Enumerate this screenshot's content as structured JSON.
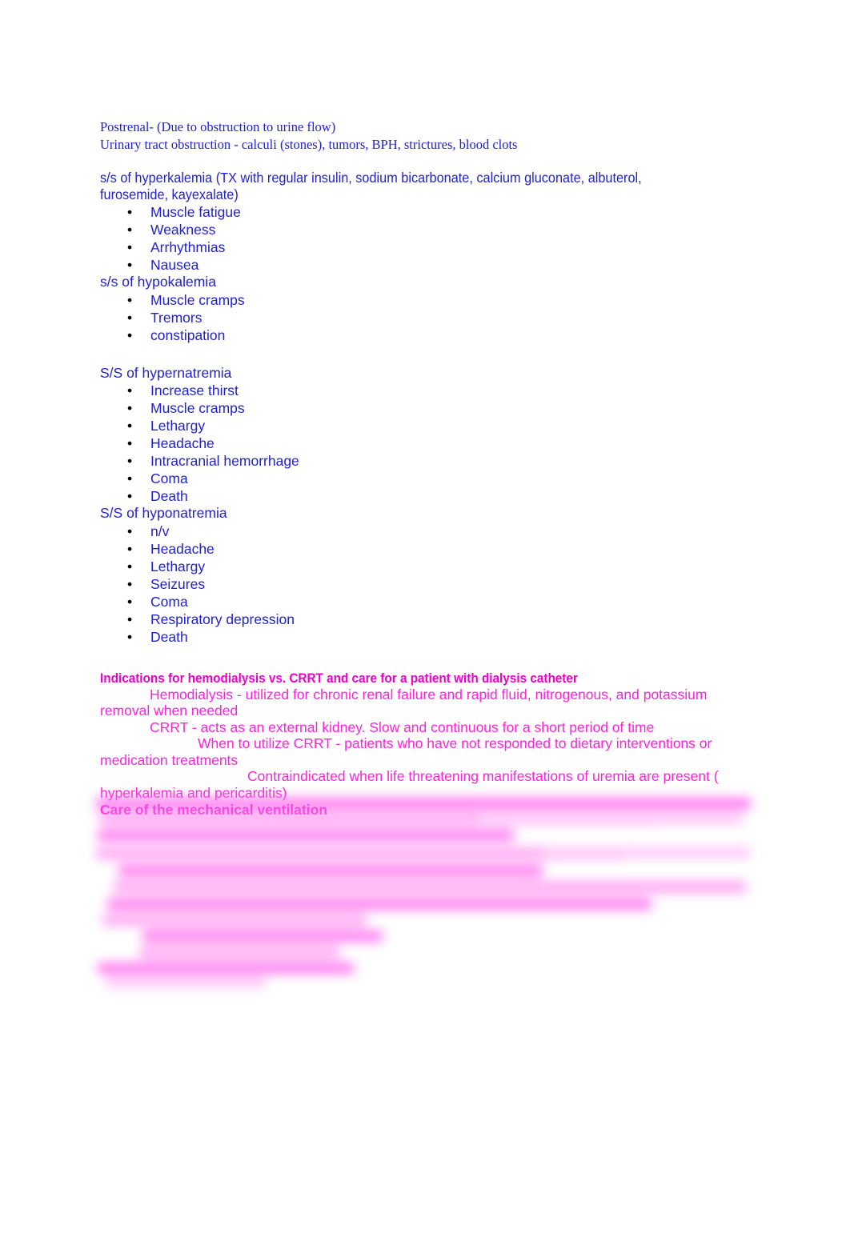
{
  "document": {
    "title": "Nursing Study Notes - Renal and Dialysis",
    "colors": {
      "blue_text": "#2222cc",
      "magenta_text": "#ff22dd",
      "magenta_heading": "#ee00cc",
      "bullet": "#000000",
      "page_background": "#ffffff"
    }
  },
  "section_postrenal": {
    "line1": "Postrenal- (Due to obstruction to urine flow)",
    "line2": "Urinary tract obstruction - calculi (stones), tumors, BPH, strictures, blood clots"
  },
  "section_hyperkalemia": {
    "heading": "s/s of hyperkalemia (TX with regular insulin, sodium bicarbonate, calcium gluconate, albuterol, furosemide, kayexalate)",
    "bullets": [
      "Muscle fatigue",
      "Weakness",
      "Arrhythmias",
      "Nausea"
    ]
  },
  "section_hypokalemia": {
    "heading": "s/s of hypokalemia",
    "bullets": [
      "Muscle cramps",
      "Tremors",
      "constipation"
    ]
  },
  "section_hypernatremia": {
    "heading": "S/S of hypernatremia",
    "bullets": [
      "Increase thirst",
      "Muscle cramps",
      "Lethargy",
      "Headache",
      "Intracranial hemorrhage",
      "Coma",
      "Death"
    ]
  },
  "section_hyponatremia": {
    "heading": "S/S of hyponatremia",
    "bullets": [
      "n/v",
      "Headache",
      "Lethargy",
      "Seizures",
      "Coma",
      "Respiratory depression",
      "Death"
    ]
  },
  "section_dialysis": {
    "heading": "Indications for hemodialysis vs. CRRT and care for a patient with dialysis catheter",
    "para1": "Hemodialysis - utilized for chronic renal failure and rapid fluid, nitrogenous, and potassium removal when needed",
    "para2": "CRRT - acts as an external kidney. Slow and continuous for a short period of time",
    "para3": "When to utilize CRRT - patients who have not responded to dietary interventions or medication treatments",
    "para4": "Contraindicated when life threatening manifestations of uremia are present ( hyperkalemia and pericarditis)"
  },
  "section_ventilation": {
    "heading": "Care of the mechanical ventilation",
    "redacted_note": ""
  }
}
